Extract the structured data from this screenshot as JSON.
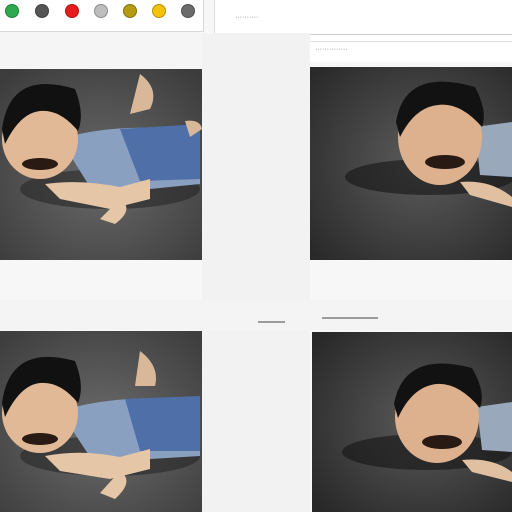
{
  "toolbar": {
    "dots": [
      {
        "name": "green-dot",
        "color": "#2fa84f"
      },
      {
        "name": "gray-dot",
        "color": "#555555"
      },
      {
        "name": "red-dot",
        "color": "#e81c1c"
      },
      {
        "name": "silver-dot",
        "color": "#bdbdbd"
      },
      {
        "name": "olive-dot",
        "color": "#b59a14"
      },
      {
        "name": "yellow-dot",
        "color": "#f2c20c"
      },
      {
        "name": "dark-gray-dot",
        "color": "#6b6b6b"
      }
    ]
  },
  "header": {
    "text_a": "··········",
    "text_b": "··········",
    "text_c": "··············"
  },
  "photos": [
    {
      "name": "photo-top-left",
      "subject": "child-lying-on-ground",
      "tone": "bright"
    },
    {
      "name": "photo-top-right",
      "subject": "child-lying-on-ground",
      "tone": "dark"
    },
    {
      "name": "photo-bottom-left",
      "subject": "child-lying-on-ground",
      "tone": "bright"
    },
    {
      "name": "photo-bottom-right",
      "subject": "child-lying-on-ground",
      "tone": "dark"
    }
  ]
}
